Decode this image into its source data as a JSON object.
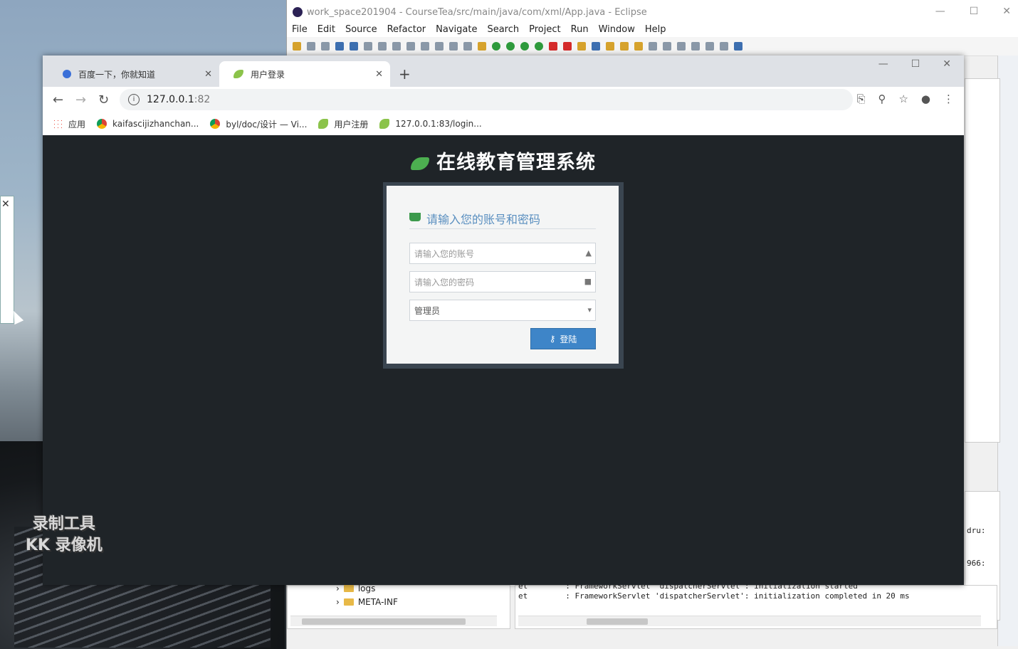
{
  "eclipse": {
    "title": "work_space201904 - CourseTea/src/main/java/com/xml/App.java - Eclipse",
    "menu": [
      "File",
      "Edit",
      "Source",
      "Refactor",
      "Navigate",
      "Search",
      "Project",
      "Run",
      "Window",
      "Help"
    ],
    "tree": [
      {
        "label": "logs"
      },
      {
        "label": "META-INF"
      }
    ],
    "console_lines": [
      "et        : FrameworkServlet 'dispatcherServlet': initialization started",
      "et        : FrameworkServlet 'dispatcherServlet': initialization completed in 20 ms"
    ],
    "side_snippets": [
      "dru:",
      "966:"
    ]
  },
  "chrome": {
    "tabs": [
      {
        "label": "百度一下，你就知道",
        "active": false
      },
      {
        "label": "用户登录",
        "active": true
      }
    ],
    "new_tab": "+",
    "url_host": "127.0.0.1",
    "url_port": ":82",
    "bookmarks": [
      {
        "label": "应用",
        "icon": "apps-icon"
      },
      {
        "label": "kaifascijizhanchan...",
        "icon": "chrome-icon"
      },
      {
        "label": "byl/doc/设计 — Vi...",
        "icon": "chrome-icon"
      },
      {
        "label": "用户注册",
        "icon": "leaf-icon"
      },
      {
        "label": "127.0.0.1:83/login...",
        "icon": "leaf-icon"
      }
    ]
  },
  "login": {
    "app_title": "在线教育管理系统",
    "heading": "请输入您的账号和密码",
    "account_placeholder": "请输入您的账号",
    "password_placeholder": "请输入您的密码",
    "role_selected": "管理员",
    "submit_label": "登陆"
  },
  "watermark": {
    "line1": "录制工具",
    "line2": "KK 录像机"
  },
  "colors": {
    "page_bg": "#1f2428",
    "accent_blue": "#3e85c8",
    "heading_blue": "#5a8fc0",
    "leaf_green": "#4caf50"
  }
}
